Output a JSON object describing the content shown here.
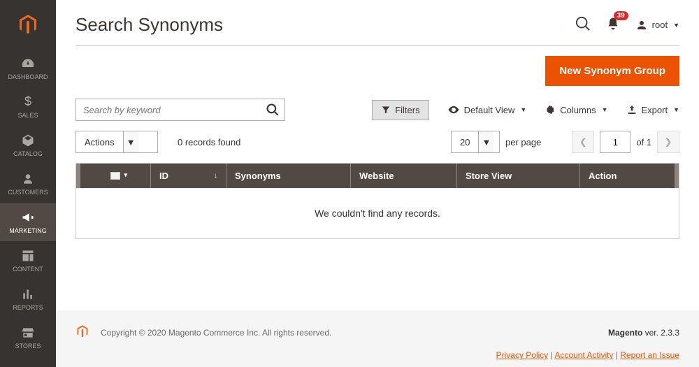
{
  "sidebar": {
    "items": [
      {
        "label": "DASHBOARD"
      },
      {
        "label": "SALES"
      },
      {
        "label": "CATALOG"
      },
      {
        "label": "CUSTOMERS"
      },
      {
        "label": "MARKETING"
      },
      {
        "label": "CONTENT"
      },
      {
        "label": "REPORTS"
      },
      {
        "label": "STORES"
      }
    ]
  },
  "header": {
    "title": "Search Synonyms",
    "notification_count": "39",
    "user_name": "root"
  },
  "actions": {
    "primary_btn": "New Synonym Group"
  },
  "toolbar": {
    "search_placeholder": "Search by keyword",
    "filters": "Filters",
    "default_view": "Default View",
    "columns": "Columns",
    "export": "Export"
  },
  "controls": {
    "actions_label": "Actions",
    "records_found": "0 records found",
    "per_page_value": "20",
    "per_page_label": "per page",
    "page_current": "1",
    "page_of": "of 1"
  },
  "table": {
    "headers": {
      "id": "ID",
      "synonyms": "Synonyms",
      "website": "Website",
      "store_view": "Store View",
      "action": "Action"
    },
    "empty_message": "We couldn't find any records."
  },
  "footer": {
    "copyright": "Copyright © 2020 Magento Commerce Inc. All rights reserved.",
    "product": "Magento",
    "version": " ver. 2.3.3",
    "links": {
      "privacy": "Privacy Policy",
      "account": "Account Activity",
      "report": "Report an Issue"
    }
  }
}
